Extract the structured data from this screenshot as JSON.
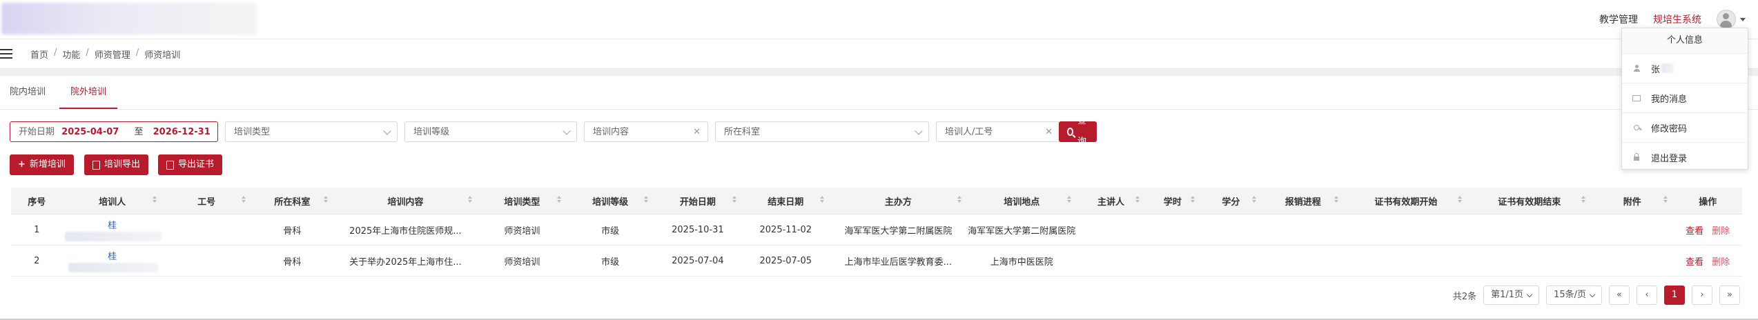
{
  "header": {
    "links": [
      "教学管理",
      "规培生系统"
    ],
    "active_link_index": 1
  },
  "breadcrumb": [
    "首页",
    "功能",
    "师资管理",
    "师资培训"
  ],
  "tabs": [
    {
      "label": "院内培训",
      "active": false
    },
    {
      "label": "院外培训",
      "active": true
    }
  ],
  "filters": {
    "date_start_label": "开始日期",
    "date_start": "2025-04-07",
    "date_to": "至",
    "date_end": "2026-12-31",
    "training_type": "培训类型",
    "training_level": "培训等级",
    "training_content": "培训内容",
    "department": "所在科室",
    "trainee": "培训人/工号",
    "search": "查询"
  },
  "actions": {
    "add": "新增培训",
    "export_training": "培训导出",
    "export_cert": "导出证书"
  },
  "table": {
    "columns": [
      "序号",
      "培训人",
      "工号",
      "所在科室",
      "培训内容",
      "培训类型",
      "培训等级",
      "开始日期",
      "结束日期",
      "主办方",
      "培训地点",
      "主讲人",
      "学时",
      "学分",
      "报销进程",
      "证书有效期开始",
      "证书有效期结束",
      "附件",
      "操作"
    ],
    "rows": [
      {
        "index": "1",
        "name": "桂",
        "dept": "骨科",
        "content": "2025年上海市住院医师规...",
        "type": "师资培训",
        "level": "市级",
        "start": "2025-10-31",
        "end": "2025-11-02",
        "host": "海军军医大学第二附属医院",
        "location": "海军军医大学第二附属医院",
        "view": "查看",
        "delete": "删除"
      },
      {
        "index": "2",
        "name": "桂",
        "dept": "骨科",
        "content": "关于举办2025年上海市住...",
        "type": "师资培训",
        "level": "市级",
        "start": "2025-07-04",
        "end": "2025-07-05",
        "host": "上海市毕业后医学教育委...",
        "location": "上海市中医医院",
        "view": "查看",
        "delete": "删除"
      }
    ]
  },
  "pagination": {
    "total": "共2条",
    "page_select": "第1/1页",
    "size_select": "15条/页",
    "first": "«",
    "prev": "‹",
    "current": "1",
    "next": "›",
    "last": "»"
  },
  "user_menu": {
    "title": "个人信息",
    "items": [
      {
        "icon": "user-icon",
        "label": "张"
      },
      {
        "icon": "mail-icon",
        "label": "我的消息"
      },
      {
        "icon": "key-icon",
        "label": "修改密码"
      },
      {
        "icon": "lock-icon",
        "label": "退出登录"
      }
    ]
  },
  "colors": {
    "accent": "#b71c2c",
    "link_blue": "#2f5fb3"
  }
}
